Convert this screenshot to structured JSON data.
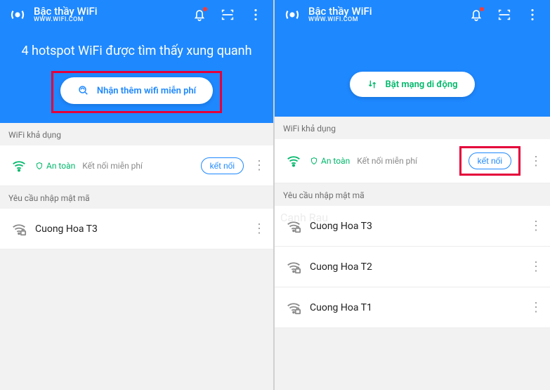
{
  "app": {
    "title": "Bậc thầy WiFi",
    "subtitle": "WWW.WIFI.COM"
  },
  "left": {
    "hero": "4 hotspot WiFi được tìm thấy xung quanh",
    "cta_label": "Nhận thêm wifi miễn phí",
    "section_available": "WiFi khả dụng",
    "safe_label": "An toàn",
    "free_label": "Kết nối miễn phí",
    "connect_label": "kết nối",
    "section_password": "Yêu cầu nhập mật mã",
    "networks_pw": [
      {
        "name": "Cuong Hoa T3"
      }
    ]
  },
  "right": {
    "cta_label": "Bật mạng di động",
    "section_available": "WiFi khả dụng",
    "safe_label": "An toàn",
    "free_label": "Kết nối miễn phí",
    "connect_label": "kết nối",
    "section_password": "Yêu cầu nhập mật mã",
    "networks_pw": [
      {
        "name": "Cuong Hoa T3"
      },
      {
        "name": "Cuong Hoa T2"
      },
      {
        "name": "Cuong Hoa T1"
      }
    ],
    "watermark": "Canh Rau"
  },
  "colors": {
    "primary": "#1e88ff",
    "green": "#00b86b",
    "highlight": "#e4003a"
  }
}
